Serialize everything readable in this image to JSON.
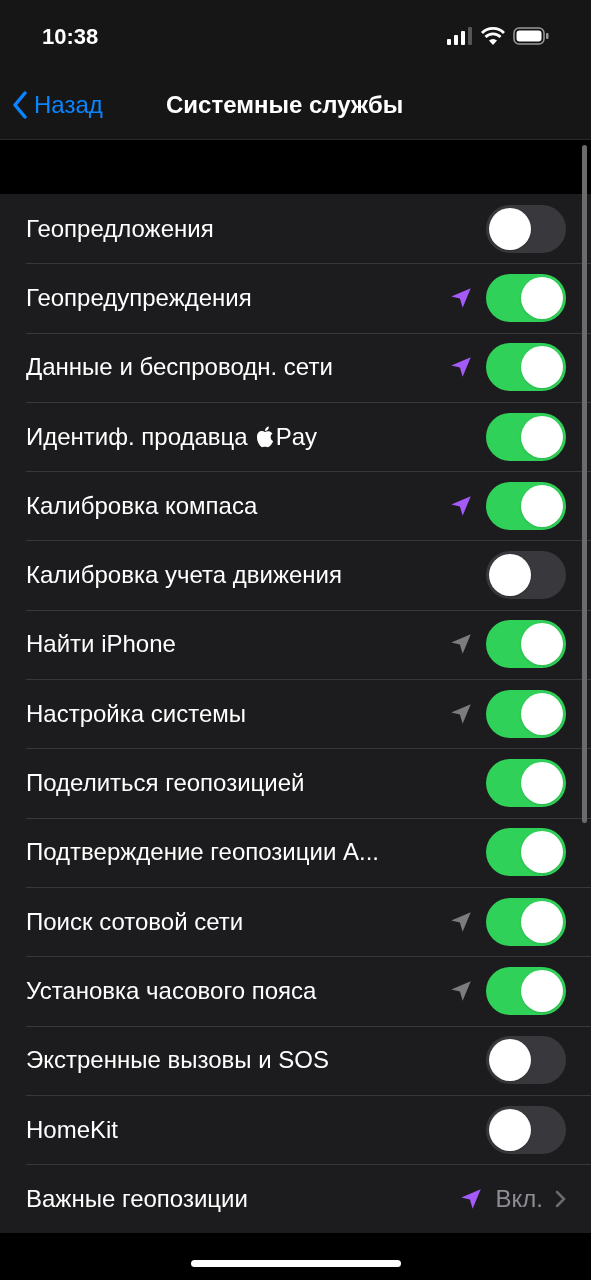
{
  "status_bar": {
    "time": "10:38"
  },
  "nav": {
    "back": "Назад",
    "title": "Системные службы"
  },
  "rows": [
    {
      "kind": "toggle",
      "label": "Геопредложения",
      "on": false
    },
    {
      "kind": "toggle",
      "label": "Геопредупреждения",
      "color": "#a45af6",
      "on": true
    },
    {
      "kind": "toggle",
      "label": "Данные и беспроводн. сети",
      "color": "#a45af6",
      "on": true
    },
    {
      "kind": "toggle",
      "label": "Идентиф. продавца",
      "suffix": "Pay",
      "on": true
    },
    {
      "kind": "toggle",
      "label": "Калибровка компаса",
      "color": "#a45af6",
      "on": true
    },
    {
      "kind": "toggle",
      "label": "Калибровка учета движения",
      "on": false
    },
    {
      "kind": "toggle",
      "label": "Найти iPhone",
      "color": "#7c7c80",
      "on": true
    },
    {
      "kind": "toggle",
      "label": "Настройка системы",
      "color": "#7c7c80",
      "on": true
    },
    {
      "kind": "toggle",
      "label": "Поделиться геопозицией",
      "on": true
    },
    {
      "kind": "toggle",
      "label": "Подтверждение геопозиции А...",
      "on": true
    },
    {
      "kind": "toggle",
      "label": "Поиск сотовой сети",
      "color": "#7c7c80",
      "on": true
    },
    {
      "kind": "toggle",
      "label": "Установка часового пояса",
      "color": "#7c7c80",
      "on": true
    },
    {
      "kind": "toggle",
      "label": "Экстренные вызовы и SOS",
      "on": false
    },
    {
      "kind": "toggle",
      "label": "HomeKit",
      "on": false
    },
    {
      "kind": "link",
      "label": "Важные геопозиции",
      "color": "#a45af6",
      "value": "Вкл."
    }
  ]
}
